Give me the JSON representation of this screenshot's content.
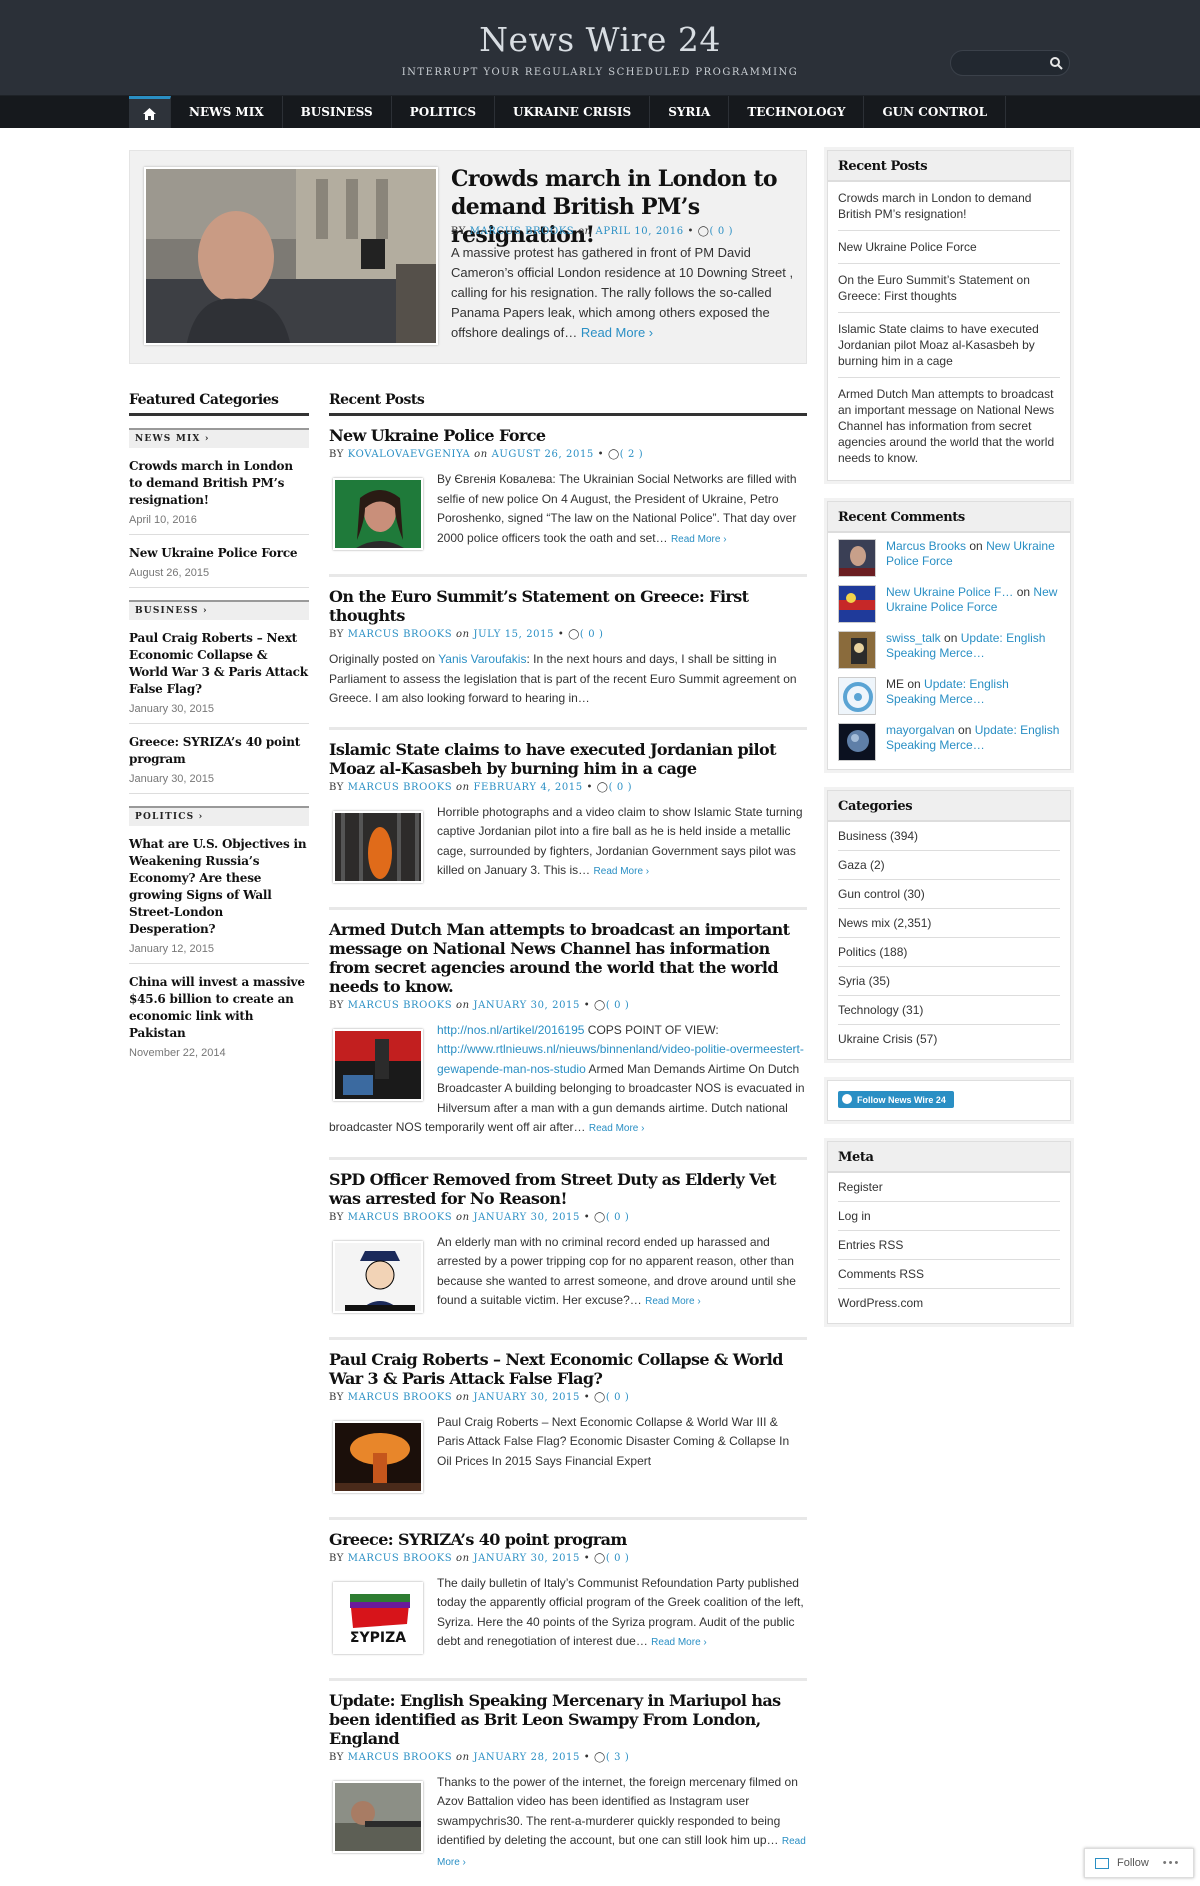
{
  "site": {
    "title": "News Wire 24",
    "tagline": "INTERRUPT YOUR REGULARLY SCHEDULED PROGRAMMING"
  },
  "nav": {
    "items": [
      "NEWS MIX",
      "BUSINESS",
      "POLITICS",
      "UKRAINE CRISIS",
      "SYRIA",
      "TECHNOLOGY",
      "GUN CONTROL"
    ]
  },
  "featured": {
    "title": "Crowds march in London to demand British PM’s resignation!",
    "by": "BY",
    "author": "MARCUS BROOKS",
    "on": "on",
    "date": "APRIL 10, 2016",
    "comments": "( 0 )",
    "excerpt": "A massive protest has gathered in front of PM David Cameron’s official London residence at 10 Downing Street , calling for his resignation. The rally follows the so-called Panama Papers leak, which among others exposed the offshore dealings of…",
    "read_more": "Read More ›"
  },
  "featured_categories": {
    "heading": "Featured Categories",
    "groups": [
      {
        "name": "NEWS MIX ›",
        "posts": [
          {
            "title": "Crowds march in London to demand British PM’s resignation!",
            "date": "April 10, 2016"
          },
          {
            "title": "New Ukraine Police Force",
            "date": "August 26, 2015"
          }
        ]
      },
      {
        "name": "BUSINESS ›",
        "posts": [
          {
            "title": "Paul Craig Roberts – Next Economic Collapse & World War 3 & Paris Attack False Flag?",
            "date": "January 30, 2015"
          },
          {
            "title": "Greece: SYRIZA’s 40 point program",
            "date": "January 30, 2015"
          }
        ]
      },
      {
        "name": "POLITICS ›",
        "posts": [
          {
            "title": "What are U.S. Objectives in Weakening Russia’s Economy? Are these growing Signs of Wall Street-London Desperation?",
            "date": "January 12, 2015"
          },
          {
            "title": "China will invest a massive $45.6 billion to create an economic link with Pakistan",
            "date": "November 22, 2014"
          }
        ]
      }
    ]
  },
  "recent_posts_main": {
    "heading": "Recent Posts",
    "posts": [
      {
        "title": "New Ukraine Police Force",
        "author": "KOVALOVAEVGENIYA",
        "date": "AUGUST 26, 2015",
        "comments": "( 2 )",
        "body": "By Євгенія Ковалева: The Ukrainian Social Networks are filled with selfie of new police On 4 August, the President of Ukraine, Petro Poroshenko, signed “The law on the National Police”. That day over 2000 police officers took the oath and set…",
        "read_more": "Read More ›"
      },
      {
        "title": "On the Euro Summit’s Statement on Greece: First thoughts",
        "author": "MARCUS BROOKS",
        "date": "JULY 15, 2015",
        "comments": "( 0 )",
        "body_prefix": "Originally posted on",
        "body_link": "Yanis Varoufakis",
        "body": ": In the next hours and days, I shall be sitting in Parliament to assess the legislation that is part of the recent Euro Summit agreement on Greece. I am also looking forward to hearing in…"
      },
      {
        "title": "Islamic State claims to have executed Jordanian pilot Moaz al-Kasasbeh by burning him in a cage",
        "author": "MARCUS BROOKS",
        "date": "FEBRUARY 4, 2015",
        "comments": "( 0 )",
        "body": "Horrible photographs and a video claim to show Islamic State turning captive Jordanian pilot into a fire ball as he is held inside a metallic cage, surrounded by fighters, Jordanian Government  says pilot was killed on January 3. This is…",
        "read_more": "Read More ›"
      },
      {
        "title": "Armed Dutch Man attempts to broadcast an important message on National News Channel has information from secret agencies around the world that the world needs to know.",
        "author": "MARCUS BROOKS",
        "date": "JANUARY 30, 2015",
        "comments": "( 0 )",
        "link1": "http://nos.nl/artikel/2016195",
        "text1": " COPS POINT OF VIEW: ",
        "link2": "http://www.rtlnieuws.nl/nieuws/binnenland/video-politie-overmeestert-gewapende-man-nos-studio",
        "body": " Armed Man Demands Airtime On Dutch Broadcaster A building belonging to broadcaster NOS is evacuated in Hilversum after a man with a gun demands airtime. Dutch national broadcaster NOS temporarily went off air after…",
        "read_more": "Read More ›"
      },
      {
        "title": "SPD Officer Removed from Street Duty as Elderly Vet was arrested for No Reason!",
        "author": "MARCUS BROOKS",
        "date": "JANUARY 30, 2015",
        "comments": "( 0 )",
        "body": "An elderly man with no criminal record ended up harassed and arrested by a power tripping cop for no apparent reason, other than because she wanted to arrest someone, and drove around until she found a suitable victim. Her excuse?…",
        "read_more": "Read More ›"
      },
      {
        "title": "Paul Craig Roberts – Next Economic Collapse & World War 3 & Paris Attack False Flag?",
        "author": "MARCUS BROOKS",
        "date": "JANUARY 30, 2015",
        "comments": "( 0 )",
        "body": "Paul Craig Roberts – Next Economic Collapse & World War III & Paris Attack False Flag? Economic Disaster Coming & Collapse In Oil Prices In 2015 Says Financial Expert"
      },
      {
        "title": "Greece: SYRIZA’s 40 point program",
        "author": "MARCUS BROOKS",
        "date": "JANUARY 30, 2015",
        "comments": "( 0 )",
        "body": "The daily bulletin of Italy’s Communist Refoundation Party published today the apparently official program of the Greek coalition of the left, Syriza. Here the 40 points of the Syriza program. Audit of the public debt and renegotiation of interest due…",
        "read_more": "Read More ›",
        "logo_text": "ΣΥΡΙΖΑ"
      },
      {
        "title": "Update: English Speaking Mercenary in Mariupol has been identified as Brit Leon Swampy From London, England",
        "author": "MARCUS BROOKS",
        "date": "JANUARY 28, 2015",
        "comments": "( 3 )",
        "body": "Thanks to the power of the internet, the foreign mercenary filmed on Azov Battalion video has been identified as Instagram user swampychris30. The rent-a-murderer quickly responded to being identified by deleting the account, but one can still look him up…",
        "read_more": "Read More ›"
      }
    ]
  },
  "meta_words": {
    "by": "BY",
    "on": "on"
  },
  "sidebar": {
    "recent_posts": {
      "heading": "Recent Posts",
      "items": [
        "Crowds march in London to demand British PM’s resignation!",
        "New Ukraine Police Force",
        "On the Euro Summit’s Statement on Greece: First thoughts",
        "Islamic State claims to have executed Jordanian pilot Moaz al-Kasasbeh by burning him in a cage",
        "Armed Dutch Man attempts to broadcast an important message on National News Channel has information from secret agencies around the world that the world needs to know."
      ]
    },
    "recent_comments": {
      "heading": "Recent Comments",
      "items": [
        {
          "author": "Marcus Brooks",
          "on": "on",
          "post": "New Ukraine Police Force"
        },
        {
          "author": "New Ukraine Police F…",
          "on": "on",
          "post": "New Ukraine Police Force"
        },
        {
          "author": "swiss_talk",
          "on": "on",
          "post": "Update: English Speaking Merce…"
        },
        {
          "author": "ME",
          "on": "on",
          "post": "Update: English Speaking Merce…"
        },
        {
          "author": "mayorgalvan",
          "on": "on",
          "post": "Update: English Speaking Merce…"
        }
      ]
    },
    "categories": {
      "heading": "Categories",
      "items": [
        "Business (394)",
        "Gaza (2)",
        "Gun control (30)",
        "News mix (2,351)",
        "Politics (188)",
        "Syria (35)",
        "Technology (31)",
        "Ukraine Crisis (57)"
      ]
    },
    "follow": {
      "label": "Follow News Wire 24"
    },
    "meta": {
      "heading": "Meta",
      "items": [
        "Register",
        "Log in",
        "Entries RSS",
        "Comments RSS",
        "WordPress.com"
      ]
    }
  },
  "follow_bar": {
    "label": "Follow",
    "more": "•••"
  },
  "colors": {
    "accent": "#2a8fc4",
    "header": "#2b3038",
    "nav": "#16191d"
  }
}
